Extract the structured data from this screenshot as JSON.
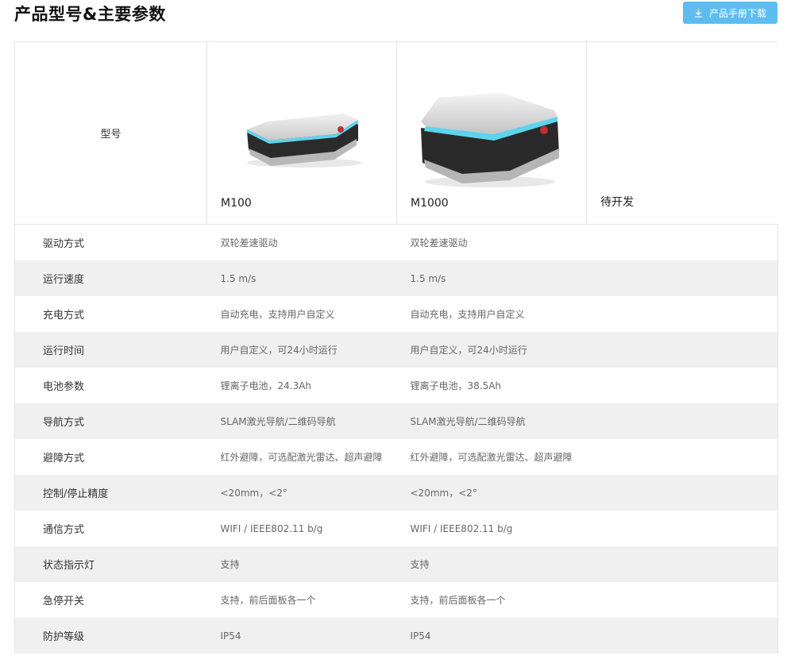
{
  "header": {
    "title": "产品型号&主要参数",
    "download_label": "产品手册下载",
    "accent": "#5dbdf1"
  },
  "models": {
    "label": "型号",
    "items": [
      "M100",
      "M1000",
      "待开发"
    ]
  },
  "params": [
    {
      "name": "驱动方式",
      "m100": "双轮差速驱动",
      "m1000": "双轮差速驱动"
    },
    {
      "name": "运行速度",
      "m100": "1.5 m/s",
      "m1000": "1.5 m/s"
    },
    {
      "name": "充电方式",
      "m100": "自动充电，支持用户自定义",
      "m1000": "自动充电，支持用户自定义"
    },
    {
      "name": "运行时间",
      "m100": "用户自定义，可24小时运行",
      "m1000": "用户自定义，可24小时运行"
    },
    {
      "name": "电池参数",
      "m100": "锂离子电池，24.3Ah",
      "m1000": "锂离子电池，38.5Ah"
    },
    {
      "name": "导航方式",
      "m100": "SLAM激光导航/二维码导航",
      "m1000": "SLAM激光导航/二维码导航"
    },
    {
      "name": "避障方式",
      "m100": "红外避障，可选配激光雷达、超声避障",
      "m1000": "红外避障，可选配激光雷达、超声避障"
    },
    {
      "name": "控制/停止精度",
      "m100": "<20mm，<2°",
      "m1000": "<20mm，<2°"
    },
    {
      "name": "通信方式",
      "m100": "WIFI / IEEE802.11 b/g",
      "m1000": "WIFI / IEEE802.11 b/g"
    },
    {
      "name": "状态指示灯",
      "m100": "支持",
      "m1000": "支持"
    },
    {
      "name": "急停开关",
      "m100": "支持，前后面板各一个",
      "m1000": "支持，前后面板各一个"
    },
    {
      "name": "防护等级",
      "m100": "IP54",
      "m1000": "IP54"
    }
  ]
}
